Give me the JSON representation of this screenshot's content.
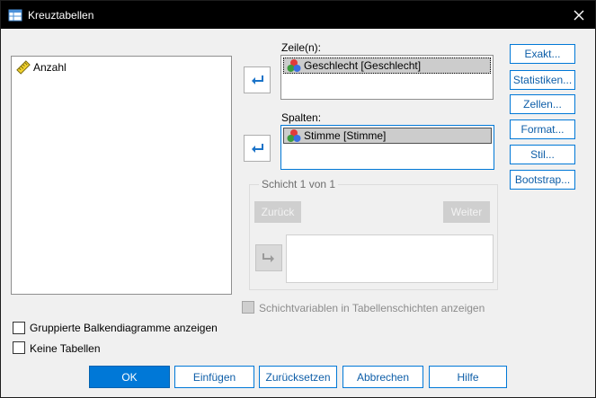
{
  "window": {
    "title": "Kreuztabellen"
  },
  "source_list": {
    "items": [
      {
        "label": "Anzahl",
        "icon": "scale-variable-icon"
      }
    ]
  },
  "rows": {
    "label": "Zeile(n):",
    "items": [
      {
        "label": "Geschlecht [Geschlecht]",
        "icon": "nominal-variable-icon"
      }
    ]
  },
  "columns": {
    "label": "Spalten:",
    "items": [
      {
        "label": "Stimme [Stimme]",
        "icon": "nominal-variable-icon"
      }
    ]
  },
  "layer": {
    "title": "Schicht 1 von 1",
    "back_label": "Zurück",
    "next_label": "Weiter"
  },
  "side_buttons": {
    "exact": "Exakt...",
    "statistics": "Statistiken...",
    "cells": "Zellen...",
    "format": "Format...",
    "style": "Stil...",
    "bootstrap": "Bootstrap..."
  },
  "options": {
    "layer_vars": "Schichtvariablen in Tabellenschichten anzeigen",
    "clustered_bars": "Gruppierte Balkendiagramme anzeigen",
    "no_tables": "Keine Tabellen"
  },
  "bottom_buttons": {
    "ok": "OK",
    "paste": "Einfügen",
    "reset": "Zurücksetzen",
    "cancel": "Abbrechen",
    "help": "Hilfe"
  },
  "colors": {
    "accent": "#0078d7",
    "titlebar": "#000000"
  }
}
